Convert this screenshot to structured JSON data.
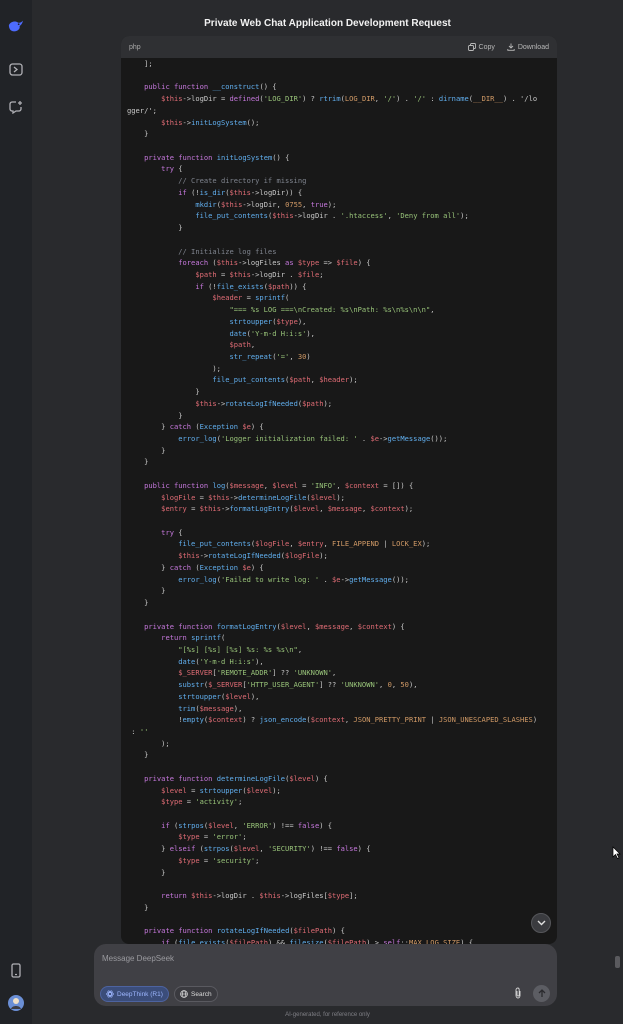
{
  "header": {
    "title": "Private Web Chat Application Development Request"
  },
  "sidebar": {
    "icons": [
      "deepseek-logo-icon",
      "sidebar-toggle-icon",
      "new-chat-icon",
      "mobile-app-icon",
      "avatar"
    ]
  },
  "code_block": {
    "language": "php",
    "copy_label": "Copy",
    "download_label": "Download",
    "lines": [
      "    ];",
      "",
      "    public function __construct() {",
      "        $this->logDir = defined('LOG_DIR') ? rtrim(LOG_DIR, '/') . '/' : dirname(__DIR__) . '/lo",
      "gger/';",
      "        $this->initLogSystem();",
      "    }",
      "",
      "    private function initLogSystem() {",
      "        try {",
      "            // Create directory if missing",
      "            if (!is_dir($this->logDir)) {",
      "                mkdir($this->logDir, 0755, true);",
      "                file_put_contents($this->logDir . '.htaccess', 'Deny from all');",
      "            }",
      "",
      "            // Initialize log files",
      "            foreach ($this->logFiles as $type => $file) {",
      "                $path = $this->logDir . $file;",
      "                if (!file_exists($path)) {",
      "                    $header = sprintf(",
      "                        \"=== %s LOG ===\\nCreated: %s\\nPath: %s\\n%s\\n\\n\",",
      "                        strtoupper($type),",
      "                        date('Y-m-d H:i:s'),",
      "                        $path,",
      "                        str_repeat('=', 30)",
      "                    );",
      "                    file_put_contents($path, $header);",
      "                }",
      "                $this->rotateLogIfNeeded($path);",
      "            }",
      "        } catch (Exception $e) {",
      "            error_log('Logger initialization failed: ' . $e->getMessage());",
      "        }",
      "    }",
      "",
      "    public function log($message, $level = 'INFO', $context = []) {",
      "        $logFile = $this->determineLogFile($level);",
      "        $entry = $this->formatLogEntry($level, $message, $context);",
      "",
      "        try {",
      "            file_put_contents($logFile, $entry, FILE_APPEND | LOCK_EX);",
      "            $this->rotateLogIfNeeded($logFile);",
      "        } catch (Exception $e) {",
      "            error_log('Failed to write log: ' . $e->getMessage());",
      "        }",
      "    }",
      "",
      "    private function formatLogEntry($level, $message, $context) {",
      "        return sprintf(",
      "            \"[%s] [%s] [%s] %s: %s %s\\n\",",
      "            date('Y-m-d H:i:s'),",
      "            $_SERVER['REMOTE_ADDR'] ?? 'UNKNOWN',",
      "            substr($_SERVER['HTTP_USER_AGENT'] ?? 'UNKNOWN', 0, 50),",
      "            strtoupper($level),",
      "            trim($message),",
      "            !empty($context) ? json_encode($context, JSON_PRETTY_PRINT | JSON_UNESCAPED_SLASHES)",
      " : ''",
      "        );",
      "    }",
      "",
      "    private function determineLogFile($level) {",
      "        $level = strtoupper($level);",
      "        $type = 'activity';",
      "",
      "        if (strpos($level, 'ERROR') !== false) {",
      "            $type = 'error';",
      "        } elseif (strpos($level, 'SECURITY') !== false) {",
      "            $type = 'security';",
      "        }",
      "",
      "        return $this->logDir . $this->logFiles[$type];",
      "    }",
      "",
      "    private function rotateLogIfNeeded($filePath) {",
      "        if (file_exists($filePath) && filesize($filePath) > self::MAX_LOG_SIZE) {"
    ]
  },
  "composer": {
    "placeholder": "Message DeepSeek",
    "deepthink_label": "DeepThink (R1)",
    "search_label": "Search"
  },
  "footer": {
    "disclaimer": "AI-generated, for reference only"
  },
  "colors": {
    "background": "#292a2d",
    "sidebar": "#212327",
    "code_bg": "#181818",
    "accent": "#4d6bfe",
    "keyword": "#c678dd",
    "string": "#98c379",
    "comment": "#7f848e",
    "variable": "#e06c75",
    "function": "#61afef",
    "number": "#d19a66"
  }
}
